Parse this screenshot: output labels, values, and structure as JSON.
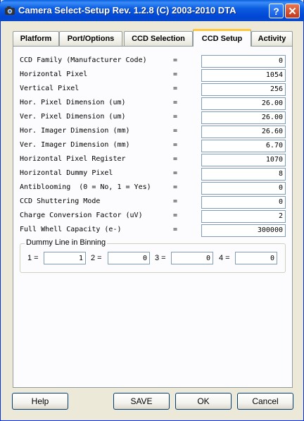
{
  "window": {
    "title": "Camera Select-Setup Rev. 1.2.8 (C) 2003-2010 DTA"
  },
  "tabs": [
    {
      "label": "Platform"
    },
    {
      "label": "Port/Options"
    },
    {
      "label": "CCD Selection"
    },
    {
      "label": "CCD Setup"
    },
    {
      "label": "Activity"
    }
  ],
  "active_tab": "CCD Setup",
  "fields": [
    {
      "label": "CCD Family (Manufacturer Code)",
      "eq": "=",
      "value": "0"
    },
    {
      "label": "Horizontal Pixel",
      "eq": "=",
      "value": "1054"
    },
    {
      "label": "Vertical Pixel",
      "eq": "=",
      "value": "256"
    },
    {
      "label": "Hor. Pixel Dimension (um)",
      "eq": "=",
      "value": "26.00"
    },
    {
      "label": "Ver. Pixel Dimension (um)",
      "eq": "=",
      "value": "26.00"
    },
    {
      "label": "Hor. Imager Dimension (mm)",
      "eq": "=",
      "value": "26.60"
    },
    {
      "label": "Ver. Imager Dimension (mm)",
      "eq": "=",
      "value": "6.70"
    },
    {
      "label": "Horizontal Pixel Register",
      "eq": "=",
      "value": "1070"
    },
    {
      "label": "Horizontal Dummy Pixel",
      "eq": "=",
      "value": "8"
    },
    {
      "label": "Antiblooming  (0 = No, 1 = Yes)",
      "eq": "=",
      "value": "0"
    },
    {
      "label": "CCD Shuttering Mode",
      "eq": "=",
      "value": "0"
    },
    {
      "label": "Charge Conversion Factor (uV)",
      "eq": "=",
      "value": "2"
    },
    {
      "label": "Full Whell Capacity (e-)",
      "eq": "=",
      "value": "300000"
    }
  ],
  "dummy_line": {
    "title": "Dummy Line in Binning",
    "items": [
      {
        "label": "1 =",
        "value": "1"
      },
      {
        "label": "2 =",
        "value": "0"
      },
      {
        "label": "3 =",
        "value": "0"
      },
      {
        "label": "4 =",
        "value": "0"
      }
    ]
  },
  "buttons": {
    "help": "Help",
    "save": "SAVE",
    "ok": "OK",
    "cancel": "Cancel"
  },
  "icons": {
    "app": "camera-icon",
    "help": "question-mark-icon",
    "close": "close-x-icon"
  },
  "colors": {
    "titlebar": "#0046d5",
    "active_tab_accent": "#ffc83c",
    "close_button": "#c2361b"
  }
}
